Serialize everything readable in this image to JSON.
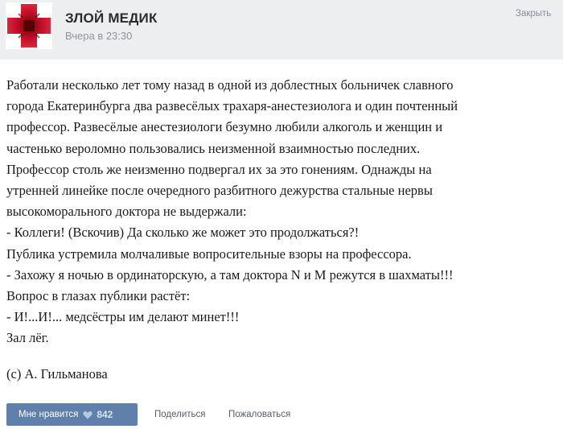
{
  "header": {
    "group_name": "ЗЛОЙ МЕДИК",
    "post_time": "Вчера в 23:30",
    "hide_label": "Закрыть",
    "avatar_icon": "red-cross-icon"
  },
  "post": {
    "lines": [
      "Работали несколько лет тому назад в одной из доблестных больничек славного",
      "города Екатеринбурга два развесёлых трахаря-анестезиолога и один почтенный",
      "профессор. Развесёлые анестезиологи безумно любили алкоголь и женщин и",
      "частенько вероломно пользовались неизменной взаимностью последних.",
      "Профессор столь же неизменно подвергал их за это гонениям. Однажды на",
      "утренней линейке после очередного разбитного дежурства стальные нервы",
      "высокоморального доктора не выдержали:",
      "- Коллеги! (Вскочив) Да сколько же может это продолжаться?!",
      "Публика устремила молчаливые вопросительные взоры на профессора.",
      "- Захожу я ночью в ординаторскую, а там доктора N и M режутся в шахматы!!!",
      "Вопрос в глазах публики растёт:",
      "- И!...И!... медсёстры им делают минет!!!",
      "Зал лёг."
    ],
    "signature": "(с) А. Гильманова"
  },
  "actions": {
    "like_label": "Мне нравится",
    "like_icon": "heart-icon",
    "like_count": "842",
    "share_label": "Поделиться",
    "report_label": "Пожаловаться"
  },
  "colors": {
    "header_bg": "#edeef0",
    "like_button": "#5e80aa",
    "avatar_red": "#c8102e"
  }
}
